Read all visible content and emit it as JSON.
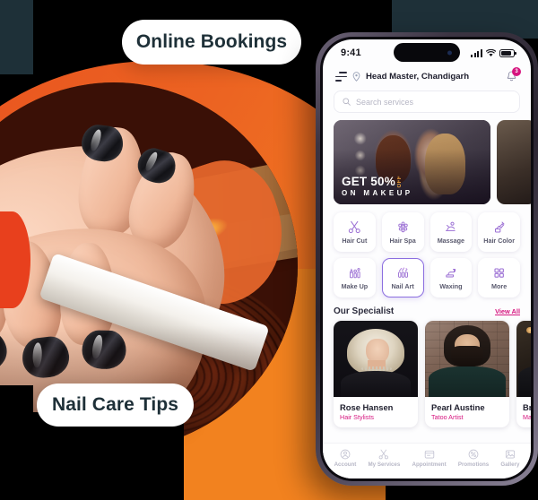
{
  "poster": {
    "pills": [
      {
        "id": "online-bookings",
        "label": "Online Bookings"
      },
      {
        "id": "nail-care-tips",
        "label": "Nail Care Tips"
      }
    ],
    "colors": {
      "orange": "#ec6322",
      "orange_light": "#f2821f",
      "teal_dark": "#1e3038",
      "pill_text": "#1e3038",
      "accent_pink": "#d6157f",
      "accent_purple": "#8b6ee0"
    }
  },
  "phone": {
    "status_bar": {
      "time": "9:41",
      "signal_icon": "signal-bars-icon",
      "wifi_icon": "wifi-icon",
      "battery_icon": "battery-icon"
    },
    "header": {
      "menu_icon": "hamburger-menu-icon",
      "location_icon": "location-pin-icon",
      "location": "Head Master, Chandigarh",
      "bell_icon": "notification-bell-icon",
      "badge_count": "3"
    },
    "search": {
      "icon": "search-icon",
      "placeholder": "Search services"
    },
    "banner": {
      "line1": "GET 50%",
      "off": "OFF",
      "line2": "ON MAKEUP"
    },
    "services": [
      {
        "label": "Hair Cut",
        "icon": "scissors-icon",
        "active": false
      },
      {
        "label": "Hair Spa",
        "icon": "hair-spa-icon",
        "active": false
      },
      {
        "label": "Massage",
        "icon": "massage-icon",
        "active": false
      },
      {
        "label": "Hair Color",
        "icon": "hair-color-icon",
        "active": false
      },
      {
        "label": "Make Up",
        "icon": "makeup-icon",
        "active": false
      },
      {
        "label": "Nail Art",
        "icon": "nail-art-icon",
        "active": true
      },
      {
        "label": "Waxing",
        "icon": "waxing-icon",
        "active": false
      },
      {
        "label": "More",
        "icon": "grid-more-icon",
        "active": false
      }
    ],
    "specialists": {
      "title": "Our Specialist",
      "view_all": "View All",
      "items": [
        {
          "name": "Rose Hansen",
          "role": "Hair Stylists"
        },
        {
          "name": "Pearl Austine",
          "role": "Tatoo Artist"
        },
        {
          "name": "Brian Parsons",
          "role": "Massage Specialist"
        }
      ]
    },
    "bottom_nav": [
      {
        "label": "Account",
        "icon": "account-icon"
      },
      {
        "label": "My Services",
        "icon": "scissors-icon"
      },
      {
        "label": "Appointment",
        "icon": "calendar-icon"
      },
      {
        "label": "Promotions",
        "icon": "promotion-tag-icon"
      },
      {
        "label": "Gallery",
        "icon": "gallery-image-icon"
      }
    ]
  }
}
